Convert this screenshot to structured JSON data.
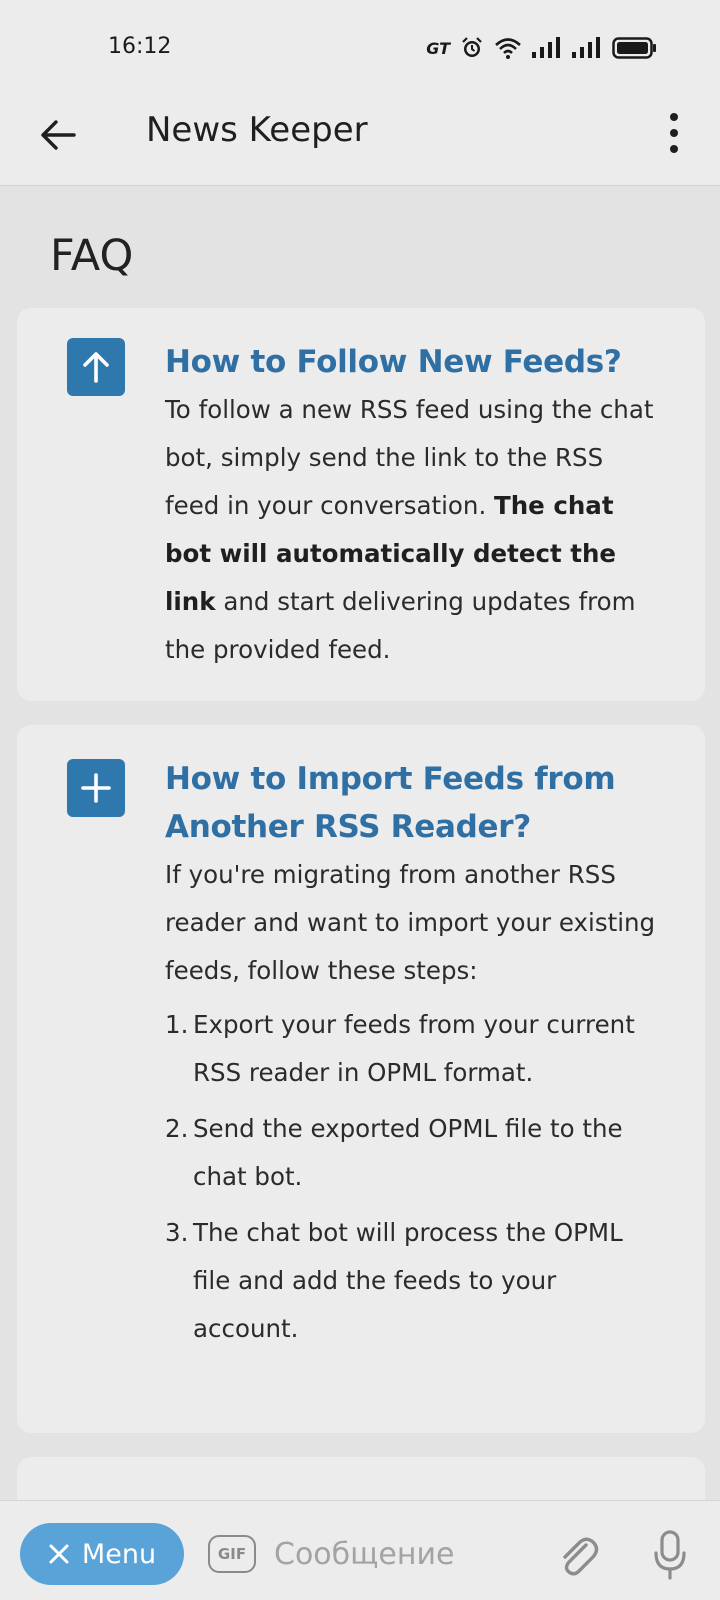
{
  "status": {
    "time": "16:12",
    "carrier_badge": "GT",
    "icons": [
      "alarm-icon",
      "wifi-icon",
      "signal-icon",
      "signal-icon",
      "battery-icon"
    ]
  },
  "appbar": {
    "title": "News Keeper"
  },
  "page": {
    "heading": "FAQ"
  },
  "faq": [
    {
      "icon": "arrow-up-icon",
      "title": "How to Follow New Feeds?",
      "text_before": "To follow a new RSS feed using the chat bot, simply send the link to the RSS feed in your conversation. ",
      "text_bold": "The chat bot will automatically detect the link",
      "text_after": " and start delivering updates from the provided feed."
    },
    {
      "icon": "plus-icon",
      "title": "How to Import Feeds from Another RSS Reader?",
      "intro": "If you're migrating from another RSS reader and want to import your existing feeds, follow these steps:",
      "steps": [
        "Export your feeds from your current RSS reader in OPML format.",
        "Send the exported OPML file to the chat bot.",
        "The chat bot will process the OPML file and add the feeds to your account."
      ]
    }
  ],
  "input": {
    "menu_label": "Menu",
    "gif_label": "GIF",
    "placeholder": "Сообщение"
  },
  "colors": {
    "accent": "#2f78ae",
    "title_blue": "#2f6fa3",
    "menu_button": "#5aa3d9"
  }
}
